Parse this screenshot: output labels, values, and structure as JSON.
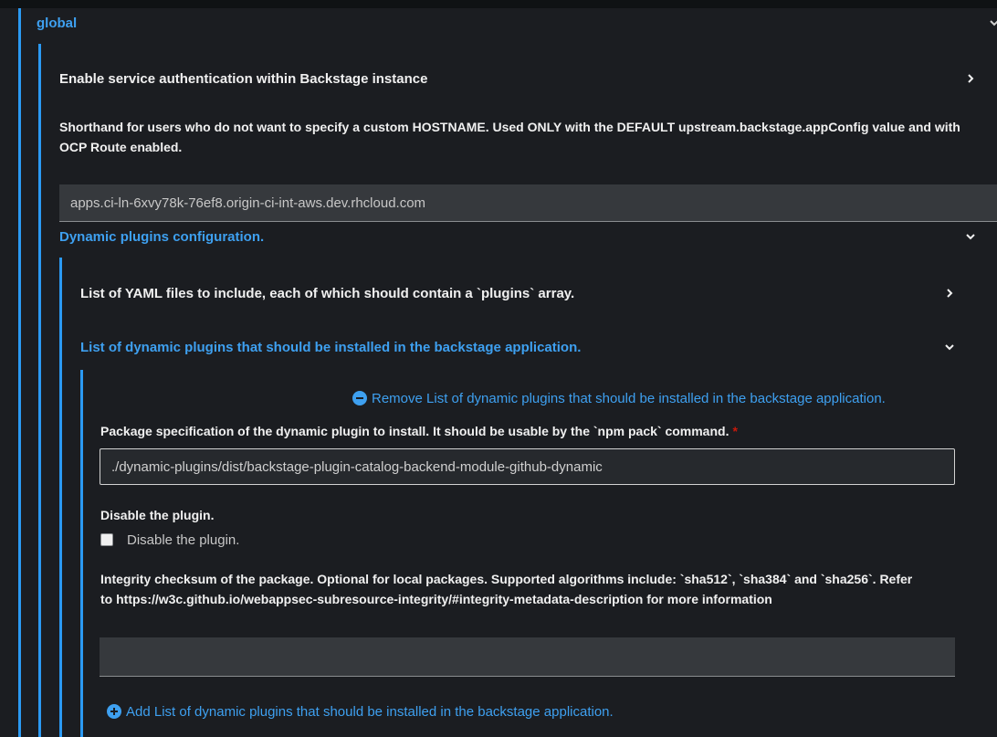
{
  "sections": {
    "global": {
      "label": "global"
    },
    "service_auth": {
      "label": "Enable service authentication within Backstage instance"
    },
    "host": {
      "description": "Shorthand for users who do not want to specify a custom HOSTNAME. Used ONLY with the DEFAULT upstream.backstage.appConfig value and with OCP Route enabled.",
      "value": "apps.ci-ln-6xvy78k-76ef8.origin-ci-int-aws.dev.rhcloud.com"
    },
    "dynamic": {
      "label": "Dynamic plugins configuration."
    },
    "includes": {
      "label": "List of YAML files to include, each of which should contain a `plugins` array."
    },
    "plugins": {
      "label": "List of dynamic plugins that should be installed in the backstage application."
    }
  },
  "plugin_item": {
    "remove_label": "Remove List of dynamic plugins that should be installed in the backstage application.",
    "package_label": "Package specification of the dynamic plugin to install. It should be usable by the `npm pack` command.",
    "package_required": "*",
    "package_value": "./dynamic-plugins/dist/backstage-plugin-catalog-backend-module-github-dynamic",
    "disabled_label": "Disable the plugin.",
    "disabled_checkbox_label": "Disable the plugin.",
    "integrity_label": "Integrity checksum of the package. Optional for local packages. Supported algorithms include: `sha512`, `sha384` and `sha256`. Refer to https://w3c.github.io/webappsec-subresource-integrity/#integrity-metadata-description for more information",
    "integrity_value": ""
  },
  "add_label": "Add List of dynamic plugins that should be installed in the backstage application.",
  "colors": {
    "accent": "#2b9af3",
    "link": "#3ea0f0",
    "required": "#c9190b",
    "background": "#1b1d21",
    "input_bg": "#36393d"
  },
  "icons": {
    "collapse": "chevron-down-icon",
    "expand": "chevron-right-icon",
    "remove": "minus-circle-icon",
    "add": "plus-circle-icon"
  }
}
